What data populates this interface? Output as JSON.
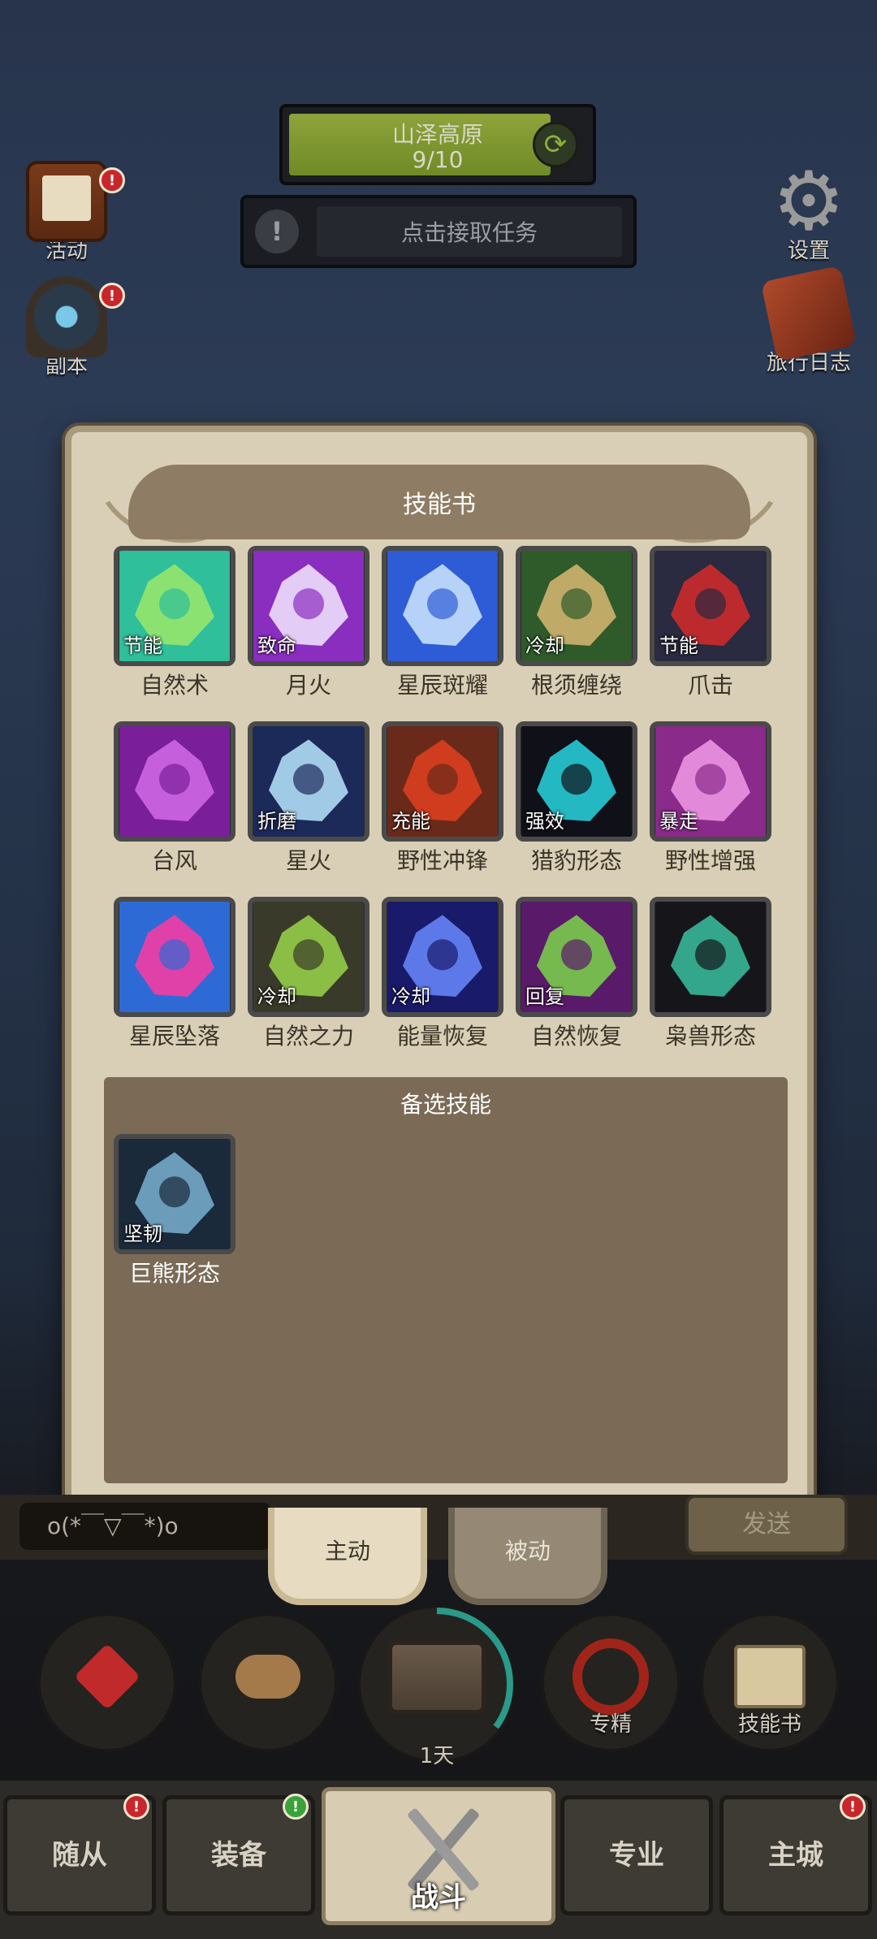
{
  "region": {
    "name": "山泽高原",
    "progress": "9/10",
    "fill_fraction": 0.9
  },
  "quest": {
    "label": "点击接取任务"
  },
  "side_left": [
    {
      "label": "活动",
      "icon": "scroll-board-icon",
      "badge": "!"
    },
    {
      "label": "副本",
      "icon": "portal-icon",
      "badge": "!"
    }
  ],
  "side_right": [
    {
      "label": "设置",
      "icon": "gear-icon"
    },
    {
      "label": "旅行日志",
      "icon": "journal-icon"
    }
  ],
  "panel": {
    "title": "技能书",
    "skills": [
      {
        "name": "自然术",
        "tag": "节能",
        "icon": "nature-orb-icon",
        "colors": [
          "#2fbf9a",
          "#9be86a"
        ]
      },
      {
        "name": "月火",
        "tag": "致命",
        "icon": "moonfire-icon",
        "colors": [
          "#8a2ec0",
          "#f2e8ff"
        ]
      },
      {
        "name": "星辰斑耀",
        "tag": "",
        "icon": "starburst-icon",
        "colors": [
          "#2e5cd6",
          "#cfe6ff"
        ]
      },
      {
        "name": "根须缠绕",
        "tag": "冷却",
        "icon": "entangling-roots-icon",
        "colors": [
          "#2f5a2a",
          "#d8b872"
        ]
      },
      {
        "name": "爪击",
        "tag": "节能",
        "icon": "claw-icon",
        "colors": [
          "#2a2a40",
          "#d62a2a"
        ]
      },
      {
        "name": "台风",
        "tag": "",
        "icon": "typhoon-icon",
        "colors": [
          "#7a1e9a",
          "#d36be8"
        ]
      },
      {
        "name": "星火",
        "tag": "折磨",
        "icon": "starfire-icon",
        "colors": [
          "#1c2a5a",
          "#b8e6ff"
        ]
      },
      {
        "name": "野性冲锋",
        "tag": "充能",
        "icon": "wild-charge-icon",
        "colors": [
          "#6a2a1a",
          "#e04020"
        ]
      },
      {
        "name": "猎豹形态",
        "tag": "强效",
        "icon": "cheetah-form-icon",
        "colors": [
          "#101018",
          "#27d6e0"
        ]
      },
      {
        "name": "野性增强",
        "tag": "暴走",
        "icon": "paw-icon",
        "colors": [
          "#8a2a8a",
          "#f29ae8"
        ]
      },
      {
        "name": "星辰坠落",
        "tag": "",
        "icon": "starfall-icon",
        "colors": [
          "#2e6ad6",
          "#ff3aa0"
        ]
      },
      {
        "name": "自然之力",
        "tag": "冷却",
        "icon": "treant-icon",
        "colors": [
          "#3a3a2a",
          "#9ad64a"
        ]
      },
      {
        "name": "能量恢复",
        "tag": "冷却",
        "icon": "lightning-icon",
        "colors": [
          "#1a1a6a",
          "#6a8aff"
        ]
      },
      {
        "name": "自然恢复",
        "tag": "回复",
        "icon": "leaf-icon",
        "colors": [
          "#5a1a6a",
          "#7ad64a"
        ]
      },
      {
        "name": "枭兽形态",
        "tag": "",
        "icon": "moonkin-form-icon",
        "colors": [
          "#15151a",
          "#3ac0a0"
        ]
      }
    ],
    "reserve_title": "备选技能",
    "reserve_skills": [
      {
        "name": "巨熊形态",
        "tag": "坚韧",
        "icon": "bear-form-icon",
        "colors": [
          "#1a2a3a",
          "#7ab0d0"
        ]
      }
    ]
  },
  "chat": {
    "text": "o(*￣▽￣*)o",
    "send": "发送"
  },
  "tabs": {
    "active": "主动",
    "passive": "被动"
  },
  "actions": [
    {
      "label": "",
      "icon": "potion-icon"
    },
    {
      "label": "",
      "icon": "bread-icon"
    },
    {
      "label": "1天",
      "icon": "treasure-chest-icon",
      "progress_fraction": 0.35
    },
    {
      "label": "专精",
      "icon": "specialization-icon"
    },
    {
      "label": "技能书",
      "icon": "skill-book-icon"
    }
  ],
  "nav": [
    {
      "label": "随从",
      "badge": "!",
      "badge_color": "#c8262a"
    },
    {
      "label": "装备",
      "badge": "!",
      "badge_color": "#3aa23a"
    },
    {
      "label": "战斗"
    },
    {
      "label": "专业"
    },
    {
      "label": "主城",
      "badge": "!",
      "badge_color": "#c8262a"
    }
  ]
}
